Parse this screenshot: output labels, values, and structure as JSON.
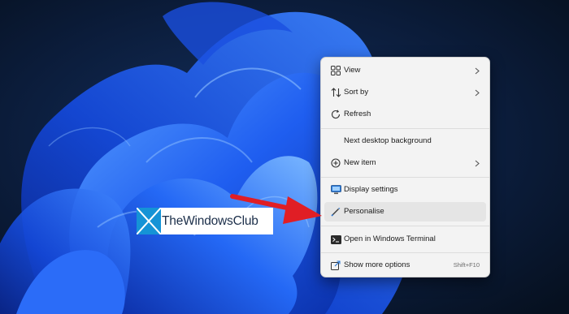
{
  "context_menu": {
    "items": [
      {
        "label": "View",
        "icon": "grid-icon",
        "has_submenu": true
      },
      {
        "label": "Sort by",
        "icon": "sort-arrows-icon",
        "has_submenu": true
      },
      {
        "label": "Refresh",
        "icon": "refresh-icon",
        "has_submenu": false
      },
      {
        "label": "Next desktop background",
        "icon": "",
        "has_submenu": false
      },
      {
        "label": "New item",
        "icon": "plus-circle-icon",
        "has_submenu": true
      },
      {
        "label": "Display settings",
        "icon": "monitor-icon",
        "has_submenu": false
      },
      {
        "label": "Personalise",
        "icon": "brush-icon",
        "has_submenu": false,
        "highlighted": true
      },
      {
        "label": "Open in Windows Terminal",
        "icon": "terminal-icon",
        "has_submenu": false
      },
      {
        "label": "Show more options",
        "icon": "share-icon",
        "has_submenu": false,
        "shortcut": "Shift+F10"
      }
    ]
  },
  "watermark": {
    "text": "TheWindowsClub",
    "logo": "thewindowsclub-logo"
  },
  "colors": {
    "menu_bg": "#f3f3f3",
    "highlight": "#e5e5e5",
    "arrow": "#e01e25",
    "wallpaper_dark": "#0a1a33",
    "wallpaper_blue": "#1f5ef0",
    "logo_blue": "#1593d6"
  }
}
